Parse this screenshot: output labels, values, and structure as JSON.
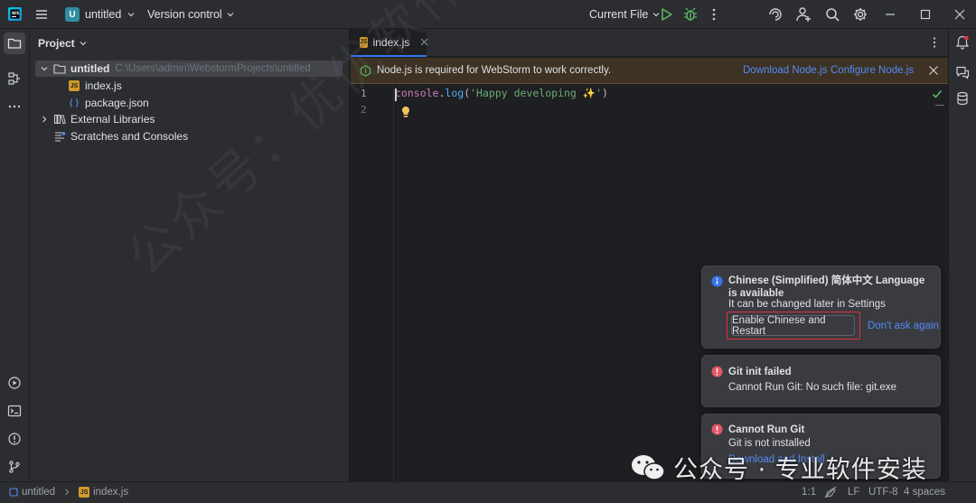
{
  "titlebar": {
    "project_initial": "U",
    "project_name": "untitled",
    "vcs_label": "Version control",
    "run_config": "Current File"
  },
  "project_panel": {
    "header": "Project",
    "tree": {
      "root_name": "untitled",
      "root_path": "C:\\Users\\admin\\WebstormProjects\\untitled",
      "file1": "index.js",
      "file2": "package.json",
      "external": "External Libraries",
      "scratches": "Scratches and Consoles"
    }
  },
  "editor": {
    "tab_badge": "JS",
    "tab_label": "index.js",
    "banner": {
      "text": "Node.js is required for WebStorm to work correctly.",
      "download_link": "Download Node.js",
      "configure_link": "Configure Node.js"
    },
    "lines": {
      "n1": "1",
      "n2": "2"
    },
    "code": {
      "ident": "console",
      "dot": ".",
      "fn": "log",
      "open": "(",
      "str": "'Happy developing ✨'",
      "close": ")"
    }
  },
  "notifications": {
    "lang": {
      "title": "Chinese (Simplified) 简体中文 Language is available",
      "body": "It can be changed later in Settings",
      "button": "Enable Chinese and Restart",
      "link": "Don't ask again"
    },
    "git_init": {
      "title": "Git init failed",
      "body": "Cannot Run Git: No such file: git.exe"
    },
    "git_run": {
      "title": "Cannot Run Git",
      "body": "Git is not installed",
      "link": "Download and Install"
    }
  },
  "statusbar": {
    "crumb_project": "untitled",
    "crumb_file": "index.js",
    "position": "1:1",
    "line_sep": "LF",
    "encoding": "UTF-8",
    "indent": "4 spaces"
  },
  "watermark": {
    "diagonal": "公众号：优优软件安装",
    "footer": "公众号 · 专业软件安装"
  },
  "colors": {
    "background": "#1e1f22",
    "panel": "#2b2d30",
    "accent": "#3574f0",
    "link": "#548af7",
    "warning_banner": "#3d3223",
    "error": "#e0303a"
  }
}
